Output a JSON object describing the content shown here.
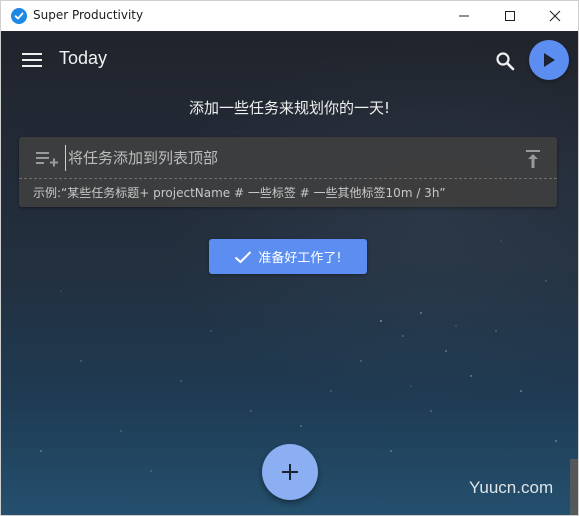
{
  "window": {
    "title": "Super Productivity"
  },
  "toolbar": {
    "title": "Today"
  },
  "main": {
    "headline": "添加一些任务来规划你的一天!",
    "add_task": {
      "placeholder": "将任务添加到列表顶部",
      "hint": "示例:“某些任务标题+ projectName # 一些标签 # 一些其他标签10m / 3h”"
    },
    "ready_button_label": "准备好工作了!"
  },
  "watermark": "Yuucn.com",
  "colors": {
    "accent": "#5c8ef2",
    "fab": "#8caef2",
    "panel": "#3e3e3e",
    "app_icon": "#1e88e5"
  },
  "icons": {
    "app": "check-circle-icon",
    "menu": "menu-icon",
    "search": "search-icon",
    "play": "play-icon",
    "playlist_add": "playlist-add-icon",
    "vertical_align_top": "vertical-align-top-icon",
    "check": "check-icon",
    "add": "plus-icon"
  }
}
